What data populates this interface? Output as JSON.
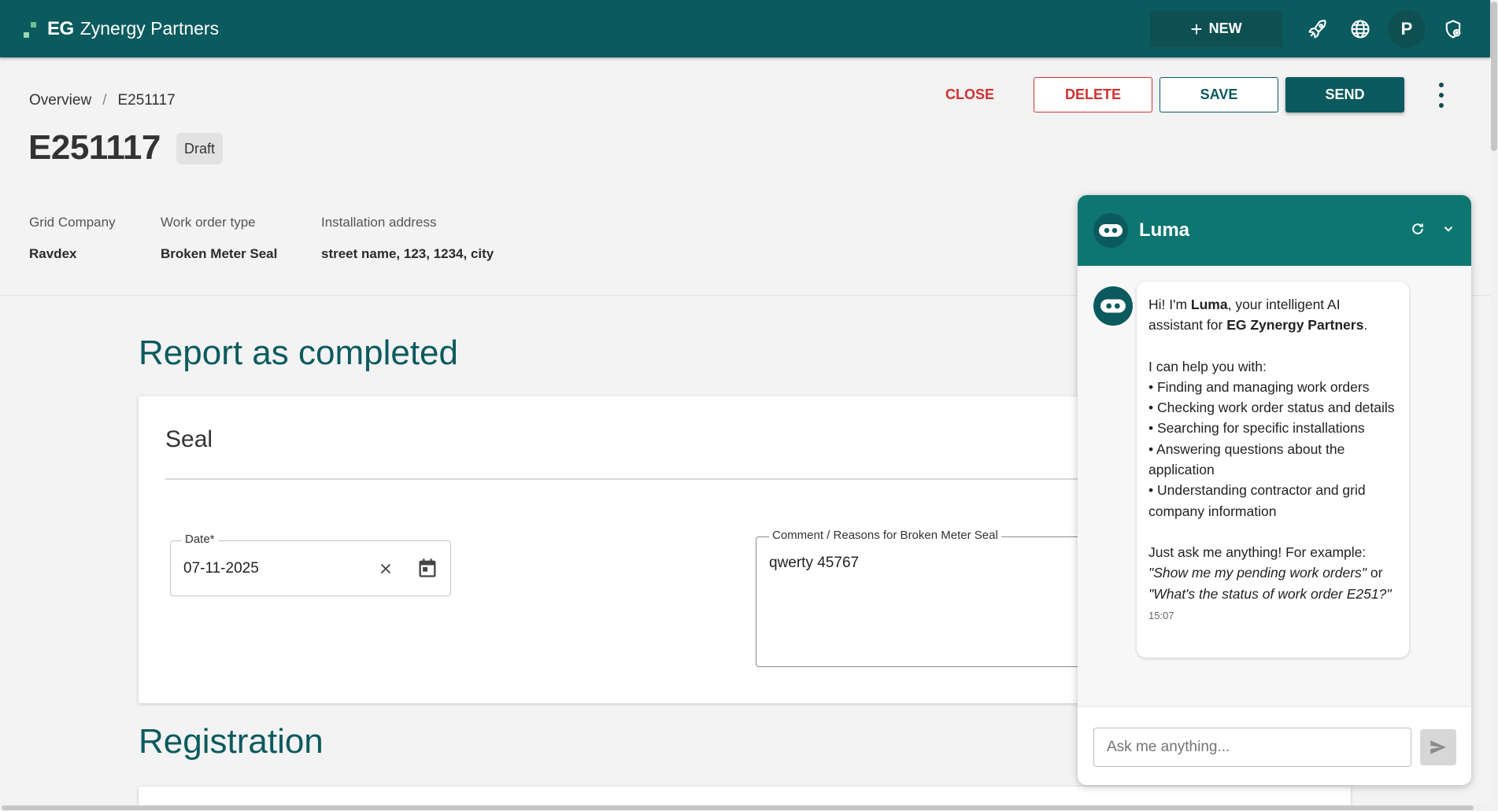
{
  "app": {
    "brand_short": "EG",
    "brand_name": "Zynergy Partners",
    "new_label": "NEW",
    "avatar_initial": "P"
  },
  "breadcrumb": {
    "root": "Overview",
    "separator": "/",
    "current": "E251117"
  },
  "page": {
    "title": "E251117",
    "status_badge": "Draft"
  },
  "actions": {
    "close": "CLOSE",
    "delete": "DELETE",
    "save": "SAVE",
    "send": "SEND"
  },
  "summary": {
    "grid_company_label": "Grid Company",
    "grid_company_value": "Ravdex",
    "work_order_type_label": "Work order type",
    "work_order_type_value": "Broken Meter Seal",
    "installation_address_label": "Installation address",
    "installation_address_value": "street name, 123, 1234, city"
  },
  "report": {
    "section_title": "Report as completed",
    "card_title": "Seal",
    "date_label": "Date*",
    "date_value": "07-11-2025",
    "comment_label": "Comment / Reasons for Broken Meter Seal",
    "comment_value": "qwerty 45767"
  },
  "registration": {
    "section_title": "Registration"
  },
  "chat": {
    "title": "Luma",
    "intro_prefix": "Hi! I'm ",
    "intro_name": "Luma",
    "intro_mid": ", your intelligent AI assistant for ",
    "intro_company": "EG Zynergy Partners",
    "intro_end": ".",
    "help_heading": "I can help you with:",
    "help_items": [
      "• Finding and managing work orders",
      "• Checking work order status and details",
      "• Searching for specific installations",
      "• Answering questions about the application",
      "• Understanding contractor and grid company information"
    ],
    "example_lead": "Just ask me anything! For example:",
    "example_1": "\"Show me my pending work orders\"",
    "example_or": " or ",
    "example_2": "\"What's the status of work order E251?\"",
    "time": "15:07",
    "input_placeholder": "Ask me anything..."
  },
  "colors": {
    "primary": "#0b5a5e",
    "chat_header": "#0e7670",
    "danger": "#d32f2f"
  },
  "icons": {
    "rocket": "rocket-icon",
    "globe": "globe-icon",
    "settings": "shield-gear-icon",
    "refresh": "refresh-icon",
    "collapse": "chevron-down-icon",
    "clear": "close-icon",
    "calendar": "calendar-icon",
    "send": "send-icon",
    "bot": "bot-icon"
  }
}
